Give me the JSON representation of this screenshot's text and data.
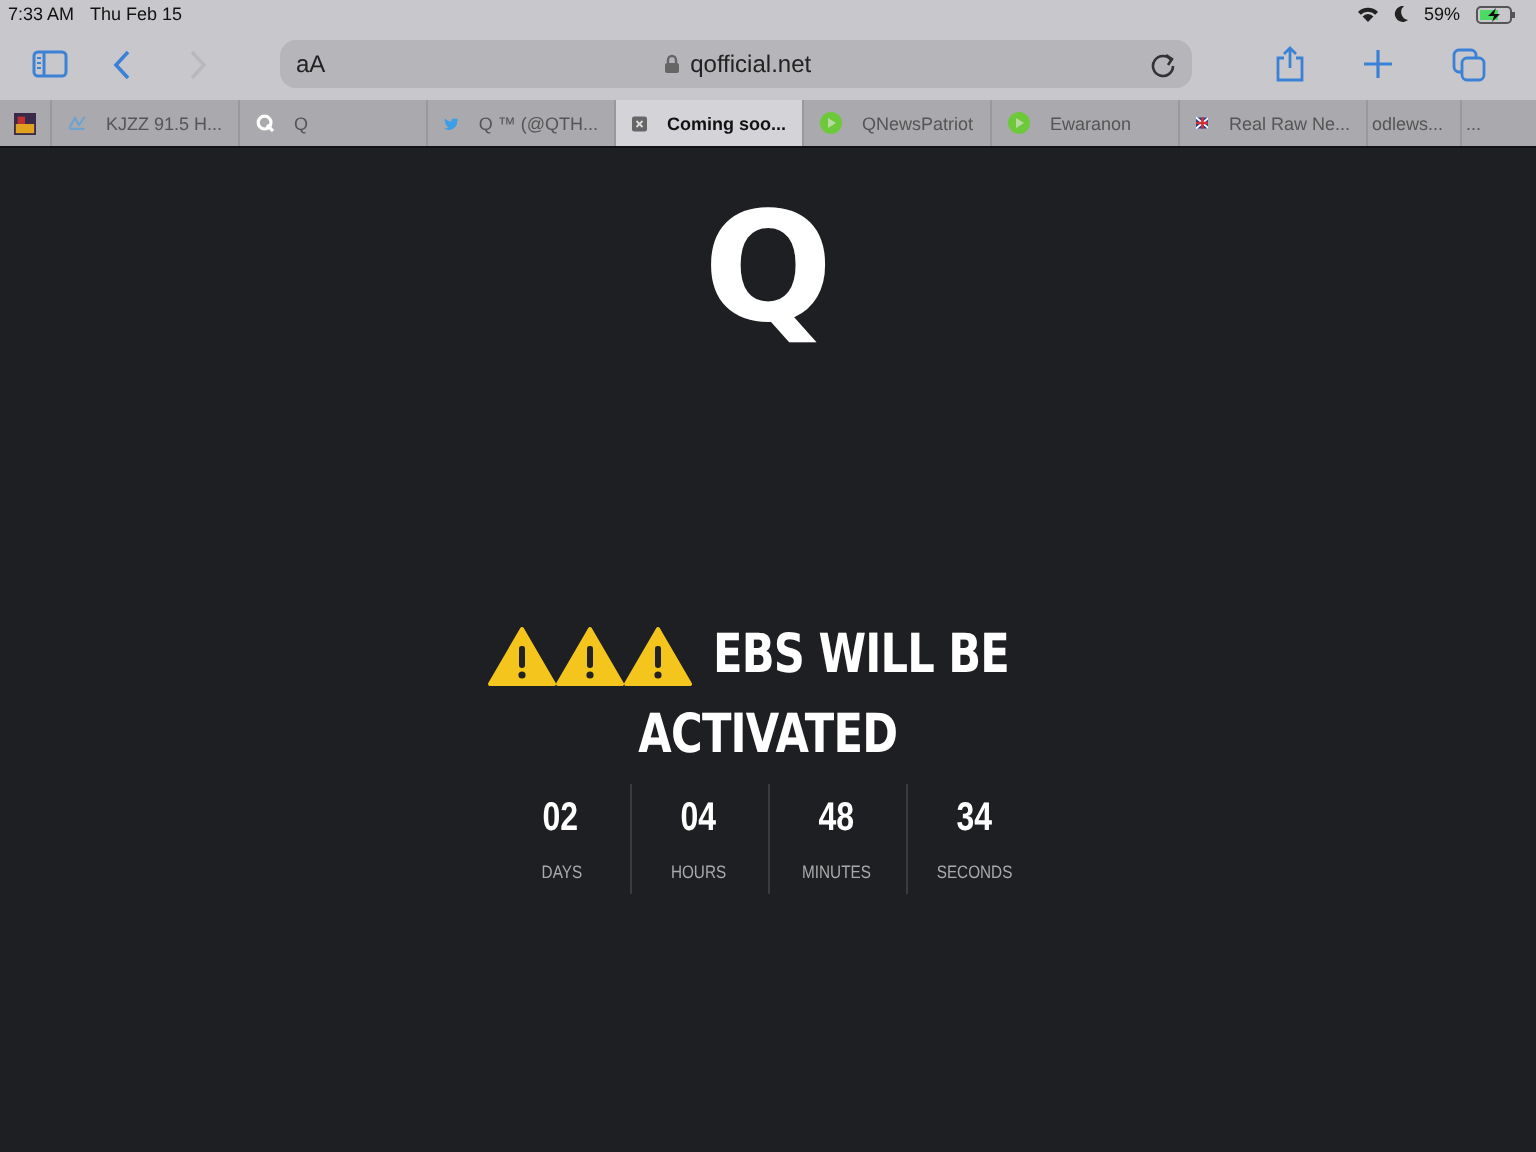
{
  "status_bar": {
    "time": "7:33 AM",
    "date": "Thu Feb 15",
    "battery": "59%"
  },
  "toolbar": {
    "reader_button": "aA",
    "url": "qofficial.net"
  },
  "tabs": [
    {
      "kind": "pinned",
      "selected": false
    },
    {
      "kind": "radio",
      "title": "KJZZ 91.5 H...",
      "selected": false
    },
    {
      "kind": "q",
      "title": "Q",
      "selected": false
    },
    {
      "kind": "bird",
      "title": "Q ™ (@QTH...",
      "selected": false
    },
    {
      "kind": "box",
      "title": "Coming soo...",
      "selected": true
    },
    {
      "kind": "play",
      "title": "QNewsPatriot",
      "selected": false
    },
    {
      "kind": "play",
      "title": "Ewaranon",
      "selected": false
    },
    {
      "kind": "flag",
      "title": "Real Raw Ne...",
      "selected": false
    },
    {
      "kind": "text",
      "title": "odlews...",
      "selected": false
    },
    {
      "kind": "text",
      "title": "...",
      "selected": false
    }
  ],
  "page": {
    "logo": "Q",
    "headline_line1": "EBS WILL BE",
    "headline_line2": "ACTIVATED",
    "countdown": [
      {
        "value": "02",
        "unit": "DAYS"
      },
      {
        "value": "04",
        "unit": "HOURS"
      },
      {
        "value": "48",
        "unit": "MINUTES"
      },
      {
        "value": "34",
        "unit": "SECONDS"
      }
    ]
  }
}
